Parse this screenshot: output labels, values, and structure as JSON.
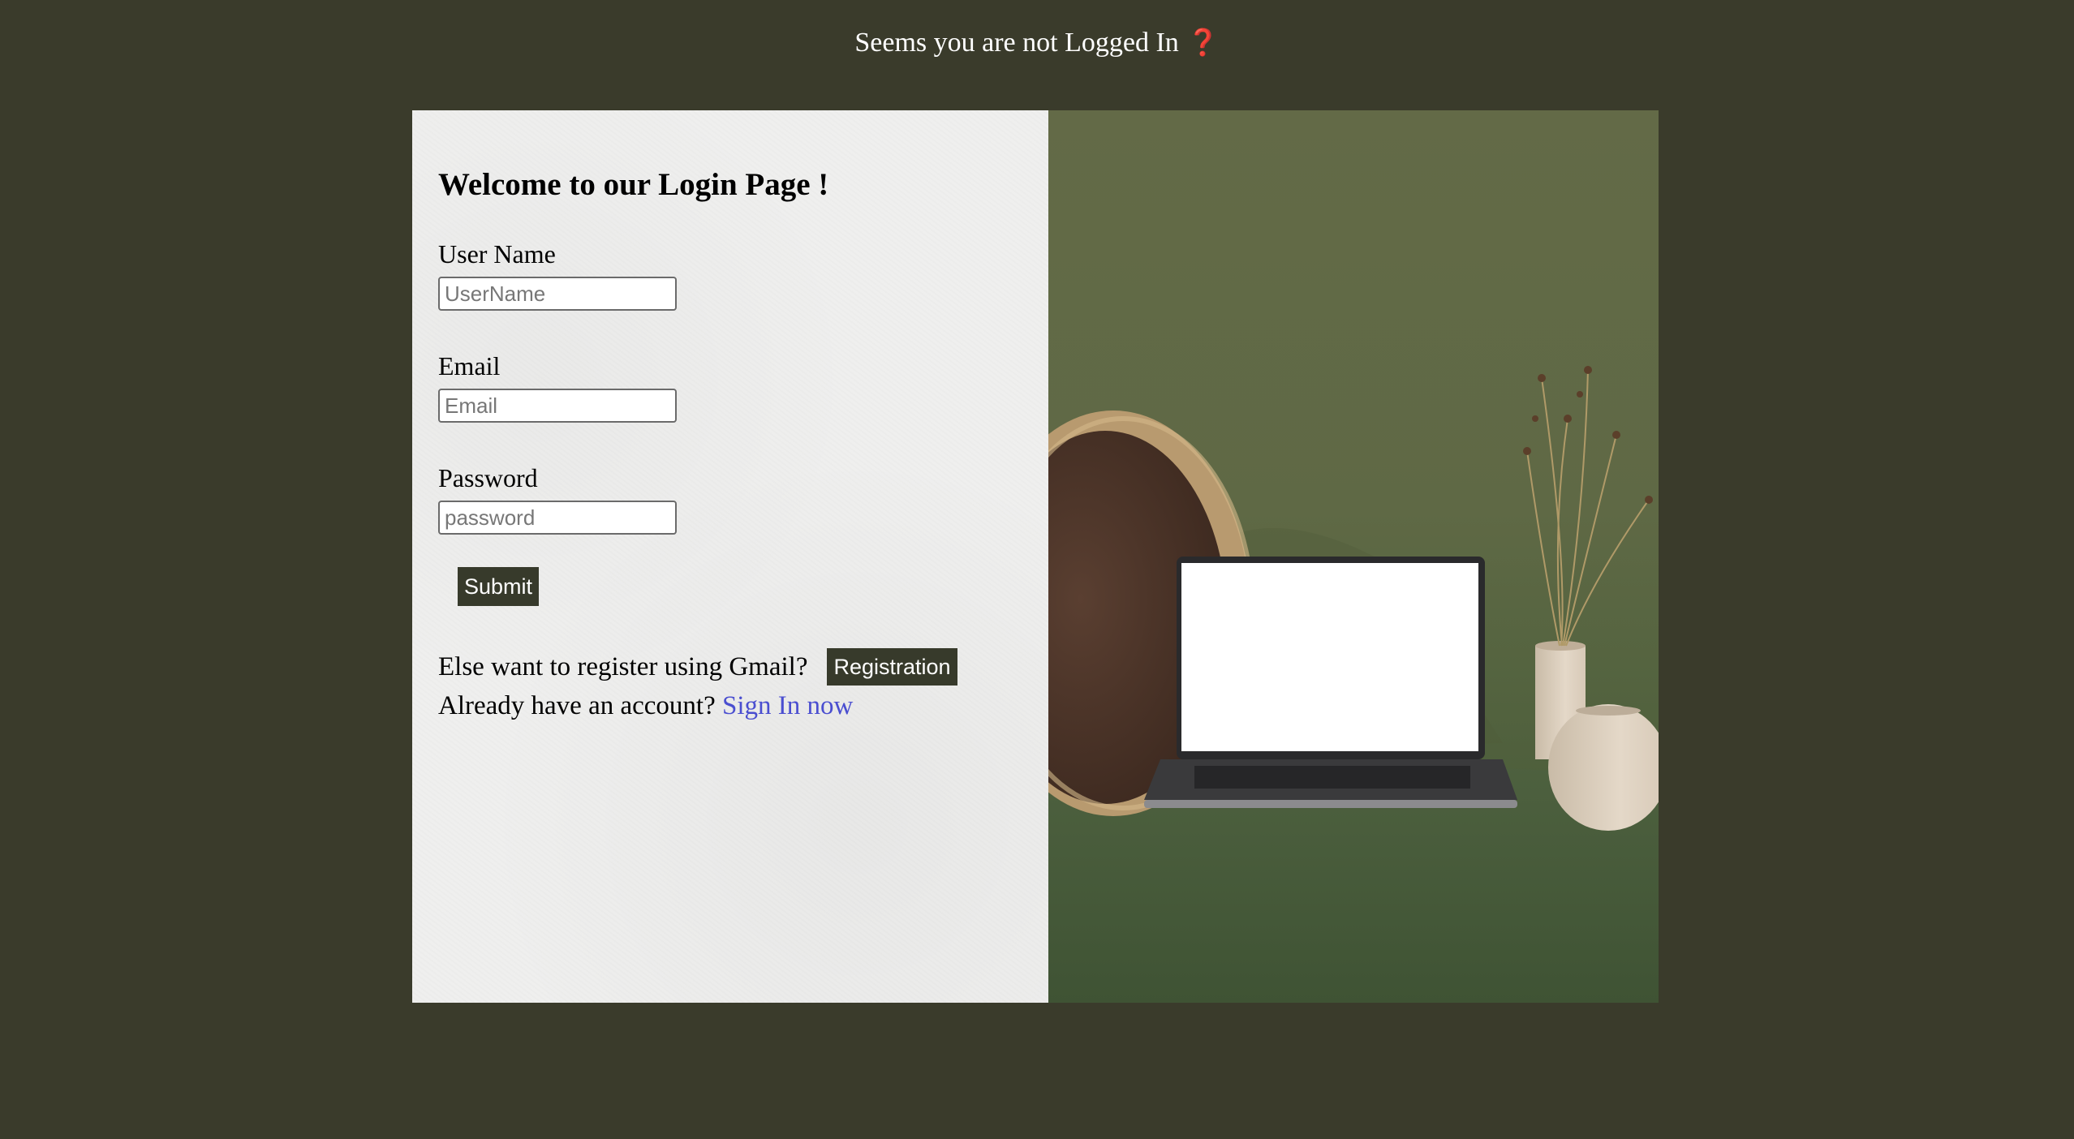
{
  "banner": {
    "text": "Seems you are not Logged In",
    "icon": "question-mark-icon",
    "icon_glyph": "❓",
    "icon_color": "#d10f0f"
  },
  "form": {
    "title": "Welcome to our Login Page !",
    "username": {
      "label": "User Name",
      "placeholder": "UserName",
      "value": ""
    },
    "email": {
      "label": "Email",
      "placeholder": "Email",
      "value": ""
    },
    "password": {
      "label": "Password",
      "placeholder": "password",
      "value": ""
    },
    "submit_label": "Submit",
    "register_prompt": "Else want to register using Gmail?",
    "register_button": "Registration",
    "signin_prompt": "Already have an account?",
    "signin_link": "Sign In now"
  },
  "colors": {
    "page_background": "#3a3b2b",
    "form_background": "#efefee",
    "button_background": "#373a2b",
    "link_color": "#4a4ed0",
    "photo_wall": "#636a47"
  },
  "hero_image": {
    "icon": "laptop-on-desk-image"
  }
}
